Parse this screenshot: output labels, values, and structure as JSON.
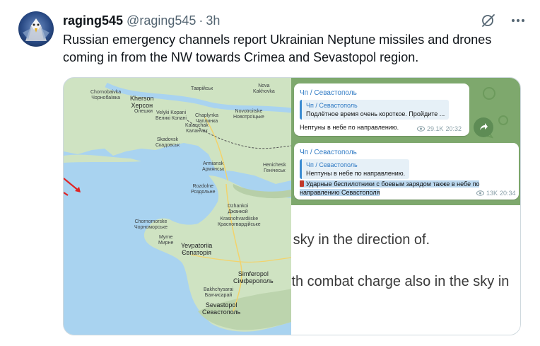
{
  "author": {
    "name": "raging545",
    "handle": "@raging545",
    "separator": "·",
    "time": "3h"
  },
  "tweet_text": "Russian emergency channels report Ukrainian Neptune missiles and drones coming in from the NW towards Crimea and Sevastopol region.",
  "icons": {
    "grok": "grok-icon",
    "more": "more-icon",
    "avatar": "eagle-avatar"
  },
  "map": {
    "labels": [
      {
        "id": "chornobayivka",
        "text": "Chornobaivka\nЧорнобаївка"
      },
      {
        "id": "kherson",
        "text": "Kherson\nХерсон"
      },
      {
        "id": "nova-kakhovka",
        "text": "Nova\nKakhovka"
      },
      {
        "id": "tavriisk",
        "text": "Таврійськ"
      },
      {
        "id": "velyki-kopani",
        "text": "Velyki Kopani\nВеликі Копані"
      },
      {
        "id": "oleshky",
        "text": "Олешки"
      },
      {
        "id": "kalanchak",
        "text": "Kalanchak\nКаланчак"
      },
      {
        "id": "chaplynka",
        "text": "Chaplynka\nЧаплинка"
      },
      {
        "id": "skadovsk",
        "text": "Skadovsk\nСкадовськ"
      },
      {
        "id": "novotroitske",
        "text": "Novotroitske\nНовотроїцьке"
      },
      {
        "id": "henichesk",
        "text": "Henichesk\nГенічеськ"
      },
      {
        "id": "armiansk",
        "text": "Armiansk\nАрмянськ"
      },
      {
        "id": "dzhankoi",
        "text": "Dzhankoi\nДжанкой"
      },
      {
        "id": "rozdolne",
        "text": "Rozdolne\nРоздольне"
      },
      {
        "id": "krasnohvardiiske",
        "text": "Krasnohvardiiske\nКрасногвардійське"
      },
      {
        "id": "chornomorske",
        "text": "Chornomorske\nЧорноморське"
      },
      {
        "id": "myrne",
        "text": "Myrne\nМирне"
      },
      {
        "id": "yevpatoriia",
        "text": "Yevpatoriia\nЄвпаторія"
      },
      {
        "id": "simferopol",
        "text": "Simferopol\nСімферополь"
      },
      {
        "id": "bakhchysarai",
        "text": "Bakhchysarai\nБахчисарай"
      },
      {
        "id": "sevastopol",
        "text": "Sevastopol\nСевастополь"
      }
    ]
  },
  "chat": {
    "message1": {
      "sender": "Чп / Севастополь",
      "quote_sender": "Чп / Севастополь",
      "quote_text": "Подлётное время очень короткое. Пройдите ...",
      "text": "Нептуны в небе по направлению.",
      "views": "29.1K",
      "time": "20:32"
    },
    "message2": {
      "sender": "Чп / Севастополь",
      "quote_sender": "Чп / Севастополь",
      "quote_text": "Нептуны в небе по направлению.",
      "text_line1": "Ударные беспилотники с боевым зарядом также в небе по",
      "text_line2": "направлению Севастополя",
      "views": "13K",
      "time": "20:34"
    }
  },
  "translation": {
    "line1": "e sky in the direction of.",
    "line2": "vith combat charge also in the sky in"
  }
}
